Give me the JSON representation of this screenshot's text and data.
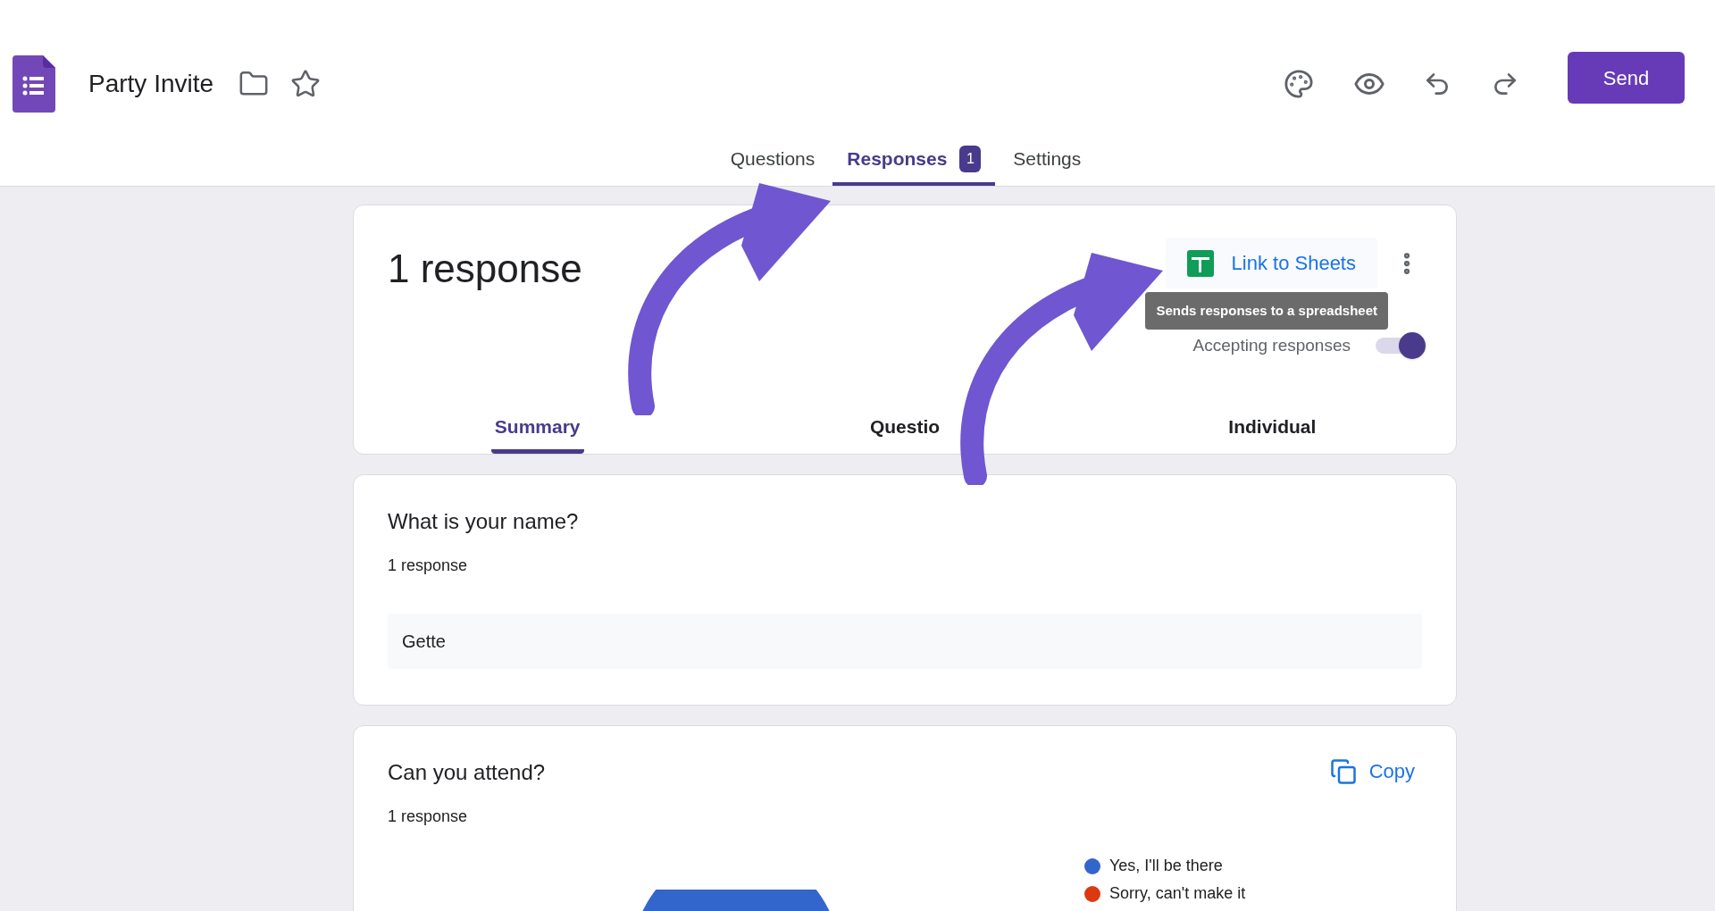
{
  "header": {
    "title": "Party Invite",
    "send_button": "Send"
  },
  "tabs": [
    {
      "label": "Questions",
      "selected": false
    },
    {
      "label": "Responses",
      "selected": true,
      "badge": "1"
    },
    {
      "label": "Settings",
      "selected": false
    }
  ],
  "summary_card": {
    "title": "1 response",
    "link_button": "Link to Sheets",
    "tooltip": "Sends responses to a spreadsheet",
    "accepting": {
      "label": "Accepting responses",
      "on": true
    },
    "subtabs": [
      {
        "label": "Summary",
        "selected": true
      },
      {
        "label": "Questio",
        "selected": false
      },
      {
        "label": "Individual",
        "selected": false
      }
    ]
  },
  "questions": [
    {
      "kind": "text",
      "title": "What is your name?",
      "count": "1 response",
      "answers": [
        "Gette"
      ]
    },
    {
      "kind": "pie",
      "title": "Can you attend?",
      "count": "1 response",
      "copy_button": "Copy",
      "legend": [
        {
          "label": "Yes, I'll be there",
          "color": "#3366cc"
        },
        {
          "label": "Sorry, can't make it",
          "color": "#dc3912"
        }
      ]
    }
  ]
}
